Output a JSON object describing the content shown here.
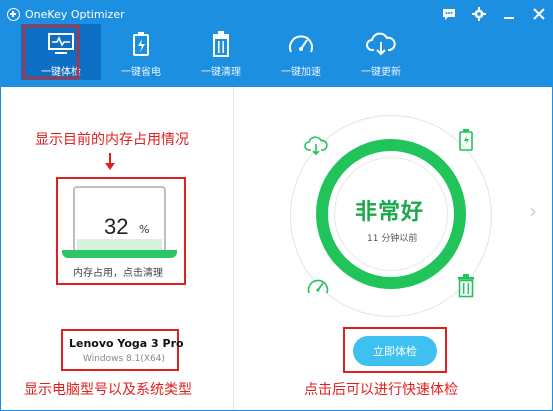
{
  "window": {
    "title": "OneKey Optimizer"
  },
  "nav": {
    "items": [
      {
        "label": "一键体检",
        "icon": "monitor-pulse-icon",
        "active": true
      },
      {
        "label": "一键省电",
        "icon": "battery-icon"
      },
      {
        "label": "一键清理",
        "icon": "trash-icon"
      },
      {
        "label": "一键加速",
        "icon": "speedometer-icon"
      },
      {
        "label": "一键更新",
        "icon": "cloud-download-icon"
      }
    ]
  },
  "memory": {
    "value": "32",
    "unit": "%",
    "caption": "内存占用，点击清理",
    "percent_used": 32
  },
  "device": {
    "model": "Lenovo Yoga 3 Pro",
    "os": "Windows 8.1(X64)"
  },
  "status": {
    "label": "非常好",
    "time": "11 分钟以前"
  },
  "actions": {
    "check_now": "立即体检"
  },
  "annotations": {
    "memory_note": "显示目前的内存占用情况",
    "device_note": "显示电脑型号以及系统类型",
    "check_note": "点击后可以进行快速体检"
  },
  "colors": {
    "titlebar": "#1d8fe0",
    "nav_active": "#0d6fc4",
    "good_green": "#21c45a",
    "annotation_red": "#e0201e",
    "button_blue": "#3ec0f0"
  }
}
